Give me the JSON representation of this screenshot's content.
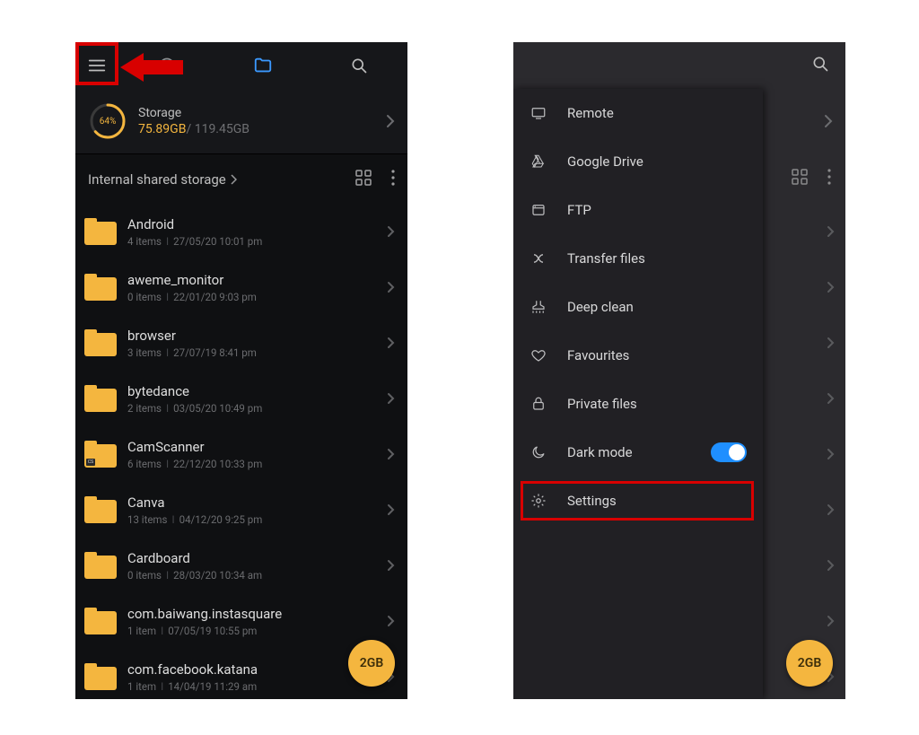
{
  "left": {
    "storage": {
      "percent_label": "64%",
      "title": "Storage",
      "used": "75.89GB",
      "separator": "/",
      "total": "119.45GB"
    },
    "breadcrumb_label": "Internal shared storage",
    "fab_label": "2GB",
    "folders": [
      {
        "name": "Android",
        "items": "4 items",
        "date": "27/05/20 10:01 pm",
        "tag": ""
      },
      {
        "name": "aweme_monitor",
        "items": "0 items",
        "date": "22/01/20 9:03 pm",
        "tag": ""
      },
      {
        "name": "browser",
        "items": "3 items",
        "date": "27/07/19 8:41 pm",
        "tag": ""
      },
      {
        "name": "bytedance",
        "items": "2 items",
        "date": "03/05/20 10:49 pm",
        "tag": ""
      },
      {
        "name": "CamScanner",
        "items": "6 items",
        "date": "22/12/20 10:33 pm",
        "tag": "CS"
      },
      {
        "name": "Canva",
        "items": "13 items",
        "date": "04/12/20 9:25 pm",
        "tag": ""
      },
      {
        "name": "Cardboard",
        "items": "0 items",
        "date": "28/03/20 10:34 am",
        "tag": ""
      },
      {
        "name": "com.baiwang.instasquare",
        "items": "1 item",
        "date": "07/05/19 10:55 pm",
        "tag": ""
      },
      {
        "name": "com.facebook.katana",
        "items": "1 item",
        "date": "14/04/19 11:29 am",
        "tag": ""
      }
    ]
  },
  "right": {
    "fab_label": "2GB",
    "drawer": [
      {
        "key": "remote",
        "label": "Remote",
        "icon": "remote"
      },
      {
        "key": "gdrive",
        "label": "Google Drive",
        "icon": "gdrive"
      },
      {
        "key": "ftp",
        "label": "FTP",
        "icon": "ftp"
      },
      {
        "key": "transfer",
        "label": "Transfer files",
        "icon": "transfer"
      },
      {
        "key": "deepclean",
        "label": "Deep clean",
        "icon": "clean"
      },
      {
        "key": "favourites",
        "label": "Favourites",
        "icon": "heart"
      },
      {
        "key": "private",
        "label": "Private files",
        "icon": "lock"
      },
      {
        "key": "darkmode",
        "label": "Dark mode",
        "icon": "moon",
        "toggle": true,
        "toggle_on": true
      },
      {
        "key": "settings",
        "label": "Settings",
        "icon": "gear",
        "highlight": true
      }
    ],
    "main_chevron_count": 9
  },
  "colors": {
    "accent": "#f4b63f",
    "toggle_on": "#1f8fff",
    "highlight": "#d80000",
    "folder_active": "#3b99ff"
  }
}
